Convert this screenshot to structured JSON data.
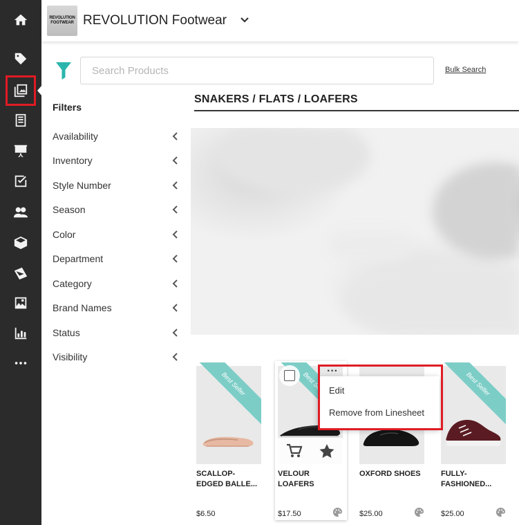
{
  "rail": {
    "items": [
      {
        "name": "home-icon"
      },
      {
        "name": "tag-icon"
      },
      {
        "name": "linesheets-icon"
      },
      {
        "name": "catalog-icon"
      },
      {
        "name": "presentation-icon"
      },
      {
        "name": "checklist-icon"
      },
      {
        "name": "users-icon"
      },
      {
        "name": "box-icon"
      },
      {
        "name": "envelope-icon"
      },
      {
        "name": "images-icon"
      },
      {
        "name": "bar-chart-icon"
      },
      {
        "name": "more-icon"
      }
    ],
    "active_index": 2
  },
  "header": {
    "logo_line1": "REVOLUTION",
    "logo_line2": "FOOTWEAR",
    "title": "REVOLUTION Footwear"
  },
  "search": {
    "placeholder": "Search Products",
    "value": "",
    "bulk_label": "Bulk Search"
  },
  "filters": {
    "title": "Filters",
    "items": [
      "Availability",
      "Inventory",
      "Style Number",
      "Season",
      "Color",
      "Department",
      "Category",
      "Brand Names",
      "Status",
      "Visibility"
    ]
  },
  "section": {
    "title": "SNAKERS / FLATS / LOAFERS"
  },
  "products": [
    {
      "name_line1": "SCALLOP-",
      "name_line2": "EDGED BALLE...",
      "price": "$6.50",
      "badge": "Best Seller"
    },
    {
      "name_line1": "VELOUR",
      "name_line2": "LOAFERS",
      "price": "$17.50",
      "badge": "Best Seller"
    },
    {
      "name_line1": "OXFORD SHOES",
      "name_line2": "",
      "price": "$25.00",
      "badge": ""
    },
    {
      "name_line1": "FULLY-",
      "name_line2": "FASHIONED...",
      "price": "$25.00",
      "badge": "Best Seller"
    }
  ],
  "context_menu": {
    "items": [
      "Edit",
      "Remove from Linesheet"
    ]
  },
  "colors": {
    "rail_bg": "#2b2b2b",
    "accent_teal": "#2bb5ad",
    "ribbon": "#7dcdc7",
    "highlight_red": "#e01b24"
  }
}
